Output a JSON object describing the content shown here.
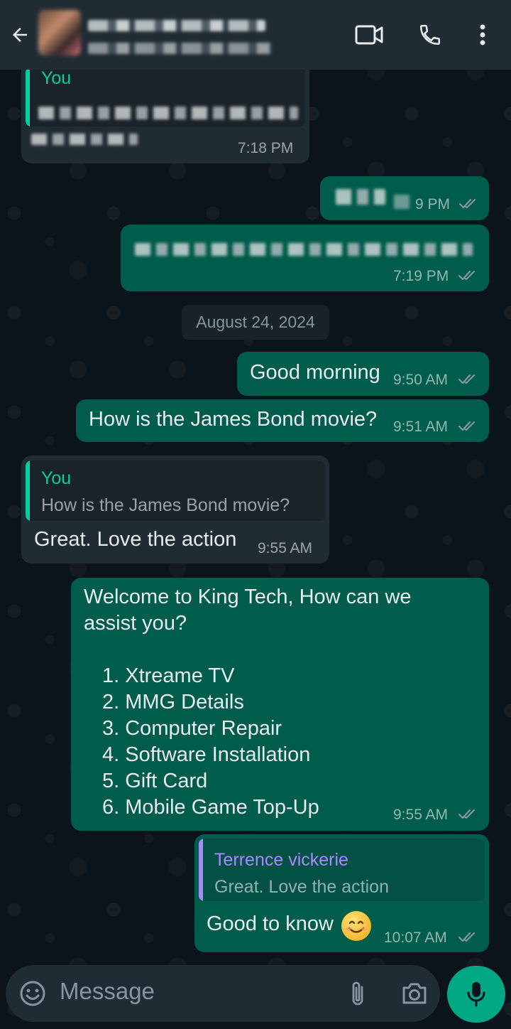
{
  "header": {
    "back_icon": "arrow-left-icon",
    "video_icon": "video-camera-icon",
    "call_icon": "phone-icon",
    "menu_icon": "more-vertical-icon"
  },
  "messages": {
    "m1": {
      "quote_author": "You",
      "time": "7:18 PM"
    },
    "m2": {
      "time": "9 PM"
    },
    "m3": {
      "time": "7:19 PM"
    },
    "date_separator": "August 24, 2024",
    "m4": {
      "text": "Good morning",
      "time": "9:50 AM"
    },
    "m5": {
      "text": "How is the James Bond movie?",
      "time": "9:51 AM"
    },
    "m6": {
      "quote_author": "You",
      "quote_text": "How is the James Bond movie?",
      "text": "Great. Love the action",
      "time": "9:55 AM"
    },
    "m7": {
      "line1": "Welcome to King Tech, How can we",
      "line2": "assist you?",
      "options": [
        "1. Xtreame TV",
        "2. MMG Details",
        "3. Computer Repair",
        "4. Software Installation",
        "5. Gift Card",
        "6. Mobile Game Top-Up"
      ],
      "time": "9:55 AM"
    },
    "m8": {
      "quote_author": "Terrence vickerie",
      "quote_text": "Great. Love the action",
      "text": "Good to know",
      "emoji": "smiling-face-emoji",
      "time": "10:07 AM"
    }
  },
  "composer": {
    "placeholder": "Message",
    "emoji_icon": "emoji-icon",
    "attach_icon": "paperclip-icon",
    "camera_icon": "camera-icon",
    "mic_icon": "microphone-icon"
  },
  "colors": {
    "background": "#0b141a",
    "header": "#1f2c34",
    "incoming": "#202c33",
    "outgoing": "#005c4b",
    "accent": "#00a884",
    "read_ticks": "#8696a0"
  }
}
